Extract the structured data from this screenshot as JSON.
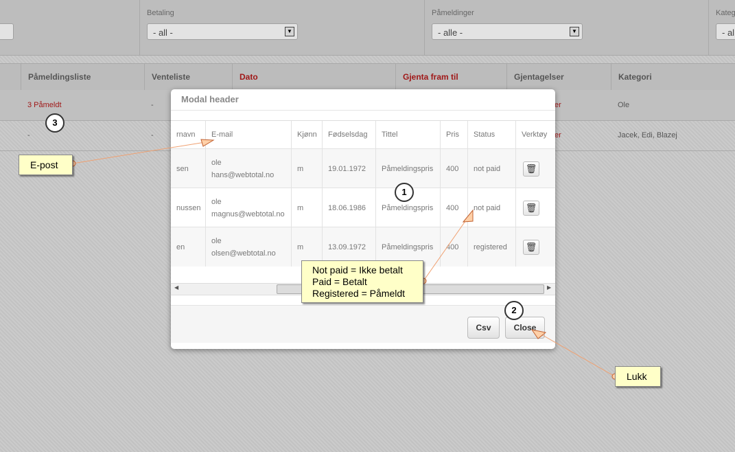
{
  "filters": {
    "betaling": {
      "label": "Betaling",
      "value": "- all -"
    },
    "pameldinger": {
      "label": "Påmeldinger",
      "value": "- alle -"
    },
    "kategori": {
      "label": "Kateg",
      "value": "- al"
    }
  },
  "table": {
    "headers": [
      "Påmeldingsliste",
      "Venteliste",
      "Dato",
      "Gjenta fram til",
      "Gjentagelser",
      "Kategori"
    ],
    "rows": [
      {
        "pameldingsliste": "3 Påmeldt",
        "venteliste": "-",
        "gjentagelser_partial": "er",
        "kategori": "Ole"
      },
      {
        "pameldingsliste": "-",
        "venteliste": "-",
        "gjentagelser_partial": "er",
        "kategori": "Jacek, Edi, Blazej"
      }
    ]
  },
  "modal": {
    "title": "Modal header",
    "columns": [
      "rnavn",
      "E-mail",
      "Kjønn",
      "Fødselsdag",
      "Tittel",
      "Pris",
      "Status",
      "Verktøy"
    ],
    "rows": [
      {
        "etternavn": "sen",
        "email_line1": "ole",
        "email_line2": "hans@webtotal.no",
        "kjonn": "m",
        "fodselsdag": "19.01.1972",
        "tittel": "Påmeldingspris",
        "pris": "400",
        "status": "not paid"
      },
      {
        "etternavn": "nussen",
        "email_line1": "ole",
        "email_line2": "magnus@webtotal.no",
        "kjonn": "m",
        "fodselsdag": "18.06.1986",
        "tittel": "Påmeldingspris",
        "pris": "400",
        "status": "not paid"
      },
      {
        "etternavn": "en",
        "email_line1": "ole",
        "email_line2": "olsen@webtotal.no",
        "kjonn": "m",
        "fodselsdag": "13.09.1972",
        "tittel": "Påmeldingspris",
        "pris": "400",
        "status": "registered"
      }
    ],
    "buttons": {
      "csv": "Csv",
      "close": "Close"
    }
  },
  "annotations": {
    "epost": "E-post",
    "status_note": [
      "Not paid = Ikke betalt",
      "Paid = Betalt",
      "Registered = Påmeldt"
    ],
    "lukk": "Lukk",
    "callouts": [
      "1",
      "2",
      "3"
    ],
    "line_color": "#f0a070"
  }
}
